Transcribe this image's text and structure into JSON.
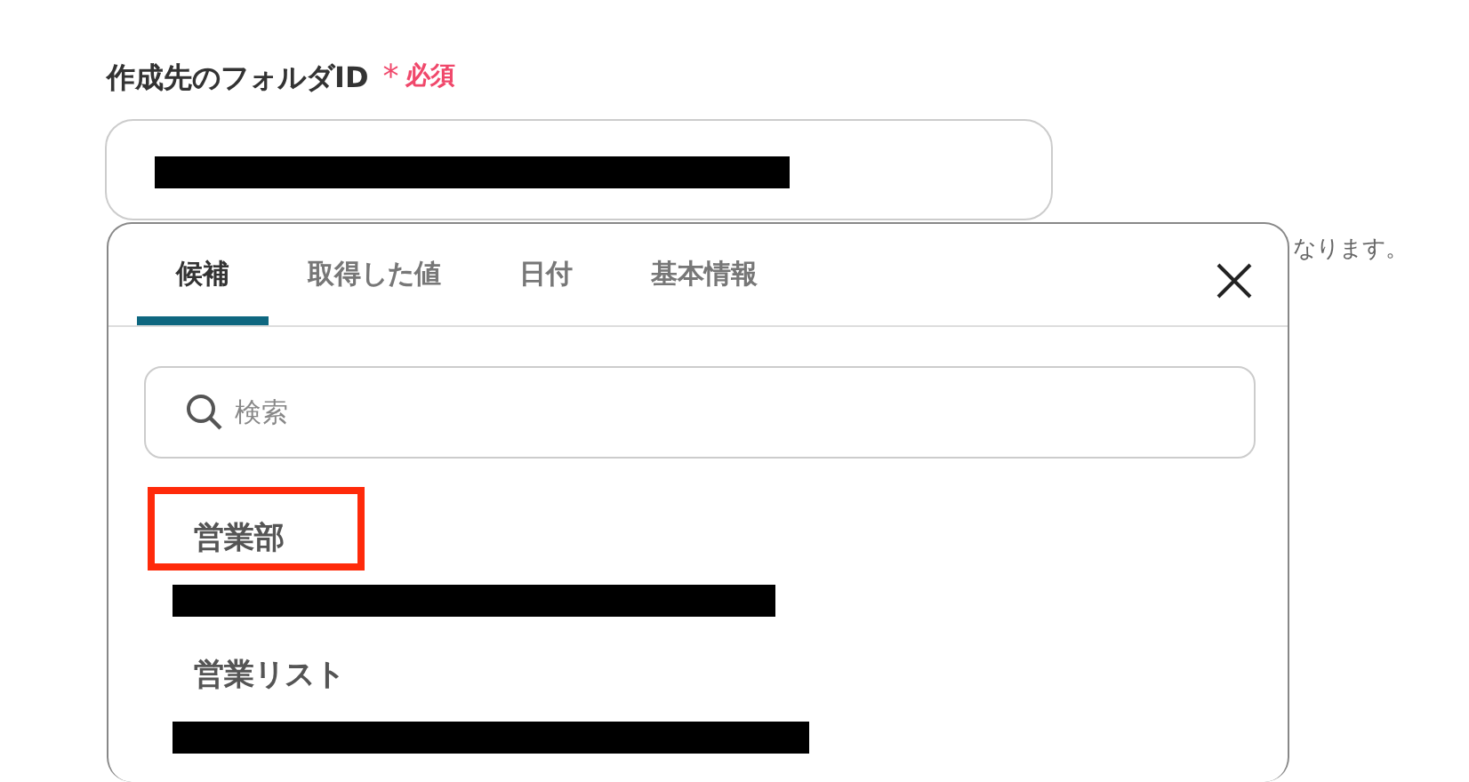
{
  "field": {
    "label": "作成先のフォルダID",
    "required_mark": "*",
    "required_text": "必須"
  },
  "hint_tail": "なります。",
  "popup": {
    "tabs": [
      {
        "label": "候補",
        "selected": true
      },
      {
        "label": "取得した値",
        "selected": false
      },
      {
        "label": "日付",
        "selected": false
      },
      {
        "label": "基本情報",
        "selected": false
      }
    ],
    "search": {
      "placeholder": "検索"
    },
    "items": [
      {
        "title": "営業部",
        "highlighted": true
      },
      {
        "title": "営業リスト",
        "highlighted": false
      }
    ]
  }
}
